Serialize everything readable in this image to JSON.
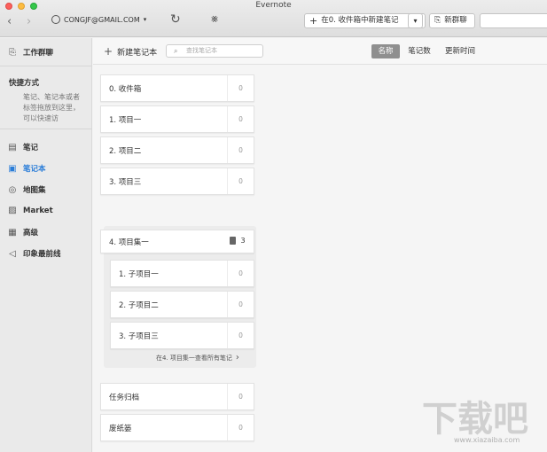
{
  "window": {
    "title": "Evernote"
  },
  "toolbar": {
    "account": "CONGJF@GMAIL.COM",
    "new_note_label": "在0. 收件箱中新建笔记",
    "new_chat_label": "新群聊"
  },
  "sidebar": {
    "work_chat": "工作群聊",
    "shortcuts_title": "快捷方式",
    "shortcuts_hint": "笔记、笔记本或者标签拖放到这里，可以快速访",
    "items": [
      {
        "label": "笔记",
        "icon": "note-icon"
      },
      {
        "label": "笔记本",
        "icon": "notebook-icon"
      },
      {
        "label": "地图集",
        "icon": "globe-icon"
      },
      {
        "label": "Market",
        "icon": "market-icon"
      },
      {
        "label": "高级",
        "icon": "premium-icon"
      },
      {
        "label": "印象最前线",
        "icon": "horn-icon"
      }
    ],
    "active_index": 1
  },
  "main": {
    "new_notebook_label": "新建笔记本",
    "search_placeholder": "查找笔记本",
    "sort_tabs": [
      "名称",
      "笔记数",
      "更新时间"
    ],
    "sort_active": 0,
    "notebooks_top": [
      {
        "name": "0. 收件箱",
        "count": "0"
      },
      {
        "name": "1. 项目一",
        "count": "0"
      },
      {
        "name": "2. 项目二",
        "count": "0"
      },
      {
        "name": "3. 项目三",
        "count": "0"
      }
    ],
    "stack": {
      "name": "4. 项目集一",
      "count": "3",
      "children": [
        {
          "name": "1. 子项目一",
          "count": "0"
        },
        {
          "name": "2. 子项目二",
          "count": "0"
        },
        {
          "name": "3. 子项目三",
          "count": "0"
        }
      ],
      "footer": "在4. 项目集一查看所有笔记"
    },
    "notebooks_bottom": [
      {
        "name": "任务归档",
        "count": "0"
      },
      {
        "name": "废纸篓",
        "count": "0"
      }
    ]
  },
  "watermark": {
    "text": "下载吧",
    "url": "www.xiazaiba.com"
  }
}
